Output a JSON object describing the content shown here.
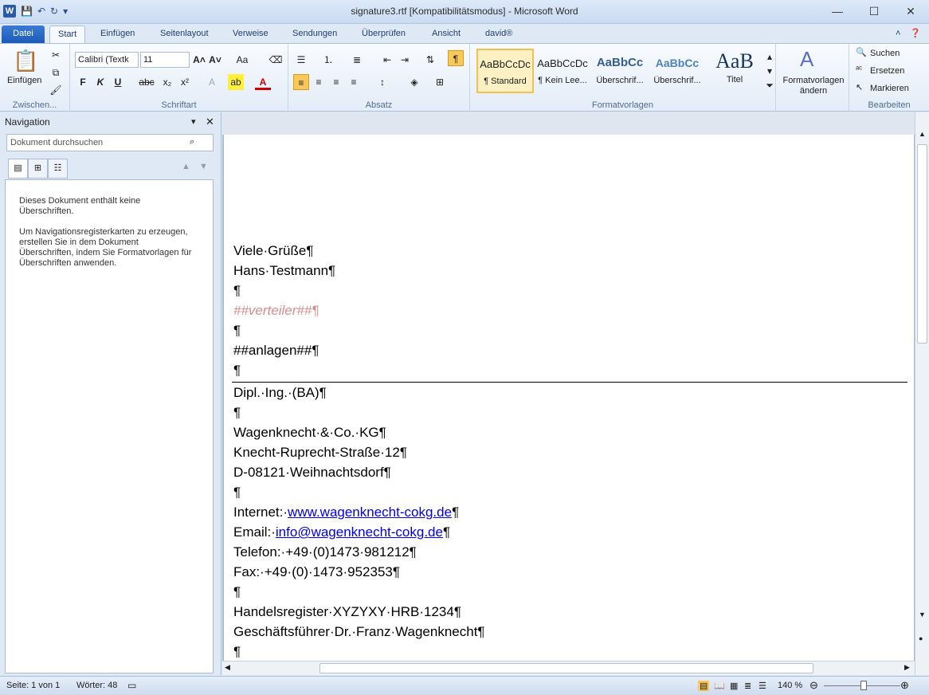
{
  "window": {
    "title": "signature3.rtf [Kompatibilitätsmodus]  -  Microsoft Word"
  },
  "qat": {
    "app_icon": "W"
  },
  "tabs": [
    "Datei",
    "Start",
    "Einfügen",
    "Seitenlayout",
    "Verweise",
    "Sendungen",
    "Überprüfen",
    "Ansicht",
    "david®"
  ],
  "ribbon": {
    "clipboard": {
      "paste_label": "Einfügen",
      "group_label": "Zwischen..."
    },
    "font": {
      "font_name": "Calibri (Textk",
      "font_size": "11",
      "group_label": "Schriftart"
    },
    "paragraph": {
      "group_label": "Absatz"
    },
    "styles": {
      "group_label": "Formatvorlagen",
      "items": [
        {
          "preview": "AaBbCcDc",
          "name": "¶ Standard"
        },
        {
          "preview": "AaBbCcDc",
          "name": "¶ Kein Lee..."
        },
        {
          "preview": "AaBbCc",
          "name": "Überschrif..."
        },
        {
          "preview": "AaBbCc",
          "name": "Überschrif..."
        },
        {
          "preview": "AaB",
          "name": "Titel"
        }
      ],
      "change_label_1": "Formatvorlagen",
      "change_label_2": "ändern"
    },
    "editing": {
      "search": "Suchen",
      "replace": "Ersetzen",
      "select": "Markieren",
      "group_label": "Bearbeiten"
    }
  },
  "nav": {
    "title": "Navigation",
    "search_placeholder": "Dokument durchsuchen",
    "msg1": "Dieses Dokument enthält keine Überschriften.",
    "msg2": "Um Navigationsregisterkarten zu erzeugen, erstellen Sie in dem Dokument Überschriften, indem Sie Formatvorlagen für Überschriften anwenden."
  },
  "document": {
    "lines_top": [
      "Viele·Grüße¶",
      "Hans·Testmann¶",
      "¶",
      "##verteiler##¶",
      "¶",
      "##anlagen##¶",
      "¶"
    ],
    "lines_bottom": [
      "Dipl.·Ing.·(BA)¶",
      "¶",
      "Wagenknecht·&·Co.·KG¶",
      "Knecht-Ruprecht-Straße·12¶",
      "D-08121·Weihnachtsdorf¶",
      "¶"
    ],
    "internet_label": "Internet:·",
    "internet_link": "www.wagenknecht-cokg.de",
    "email_label": "Email:·",
    "email_link": "info@wagenknecht-cokg.de",
    "lines_end": [
      "Telefon:·+49·(0)1473·981212¶",
      "Fax:·+49·(0)·1473·952353¶",
      "¶",
      "Handelsregister·XYZYXY·HRB·1234¶",
      "Geschäftsführer·Dr.·Franz·Wagenknecht¶",
      "¶"
    ]
  },
  "status": {
    "page": "Seite: 1 von 1",
    "words": "Wörter: 48",
    "zoom": "140 %"
  }
}
